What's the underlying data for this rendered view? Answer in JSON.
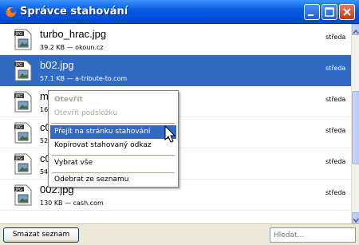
{
  "window": {
    "title": "Správce stahování"
  },
  "downloads": [
    {
      "name": "turbo_hrac.jpg",
      "meta": "39.2 KB — okoun.cz",
      "day": "středa",
      "selected": false
    },
    {
      "name": "b02.jpg",
      "meta": "57.1 KB — a-tribute-to.com",
      "day": "středa",
      "selected": true
    },
    {
      "name": "m",
      "meta": "16",
      "day": "středa",
      "selected": false
    },
    {
      "name": "c0",
      "meta": "52",
      "day": "středa",
      "selected": false
    },
    {
      "name": "c0",
      "meta": "54",
      "day": "středa",
      "selected": false
    },
    {
      "name": "002.jpg",
      "meta": "130 KB — cash.com",
      "day": "středa",
      "selected": false
    }
  ],
  "context_menu": {
    "open": "Otevřít",
    "open_folder": "Otevřít podsložku",
    "go_to_page": "Přejít na stránku stahování",
    "copy_link": "Kopírovat stahovaný odkaz",
    "select_all": "Vybrat vše",
    "remove": "Odebrat ze seznamu"
  },
  "footer": {
    "clear_list": "Smazat seznam",
    "search_placeholder": "Hledat..."
  },
  "colors": {
    "selection": "#316ac5",
    "titlebar": "#0054e3"
  }
}
